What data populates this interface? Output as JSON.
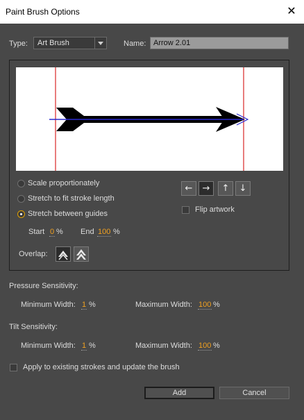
{
  "window": {
    "title": "Paint Brush Options",
    "close_icon": "close-icon"
  },
  "type": {
    "label": "Type:",
    "value": "Art Brush"
  },
  "name": {
    "label": "Name:",
    "value": "Arrow 2.01"
  },
  "scale_options": [
    {
      "label": "Scale proportionately",
      "selected": false
    },
    {
      "label": "Stretch to fit stroke length",
      "selected": false
    },
    {
      "label": "Stretch between guides",
      "selected": true
    }
  ],
  "guides": {
    "start_label": "Start",
    "start_value": "0",
    "end_label": "End",
    "end_value": "100",
    "unit": "%"
  },
  "direction_buttons": [
    {
      "icon": "arrow-left-icon",
      "glyph": "←",
      "selected": false
    },
    {
      "icon": "arrow-right-icon",
      "glyph": "→",
      "selected": true
    },
    {
      "icon": "arrow-up-icon",
      "glyph": "↑",
      "selected": false
    },
    {
      "icon": "arrow-down-icon",
      "glyph": "↓",
      "selected": false
    }
  ],
  "flip": {
    "label": "Flip artwork",
    "checked": false
  },
  "overlap": {
    "label": "Overlap:",
    "options": [
      {
        "icon": "overlap-adjust-icon",
        "selected": true
      },
      {
        "icon": "overlap-none-icon",
        "selected": false
      }
    ]
  },
  "pressure": {
    "label": "Pressure Sensitivity:",
    "min_label": "Minimum Width:",
    "min_value": "1",
    "max_label": "Maximum Width:",
    "max_value": "100",
    "unit": "%"
  },
  "tilt": {
    "label": "Tilt Sensitivity:",
    "min_label": "Minimum Width:",
    "min_value": "1",
    "max_label": "Maximum Width:",
    "max_value": "100",
    "unit": "%"
  },
  "apply": {
    "label": "Apply to existing strokes and update the brush",
    "checked": false
  },
  "buttons": {
    "add": "Add",
    "cancel": "Cancel"
  },
  "colors": {
    "dialog_bg": "#484848",
    "accent": "#f0a020",
    "guide_line": "#e05050",
    "preview_bg": "#ffffff",
    "stroke_line": "#2a2ad0"
  }
}
